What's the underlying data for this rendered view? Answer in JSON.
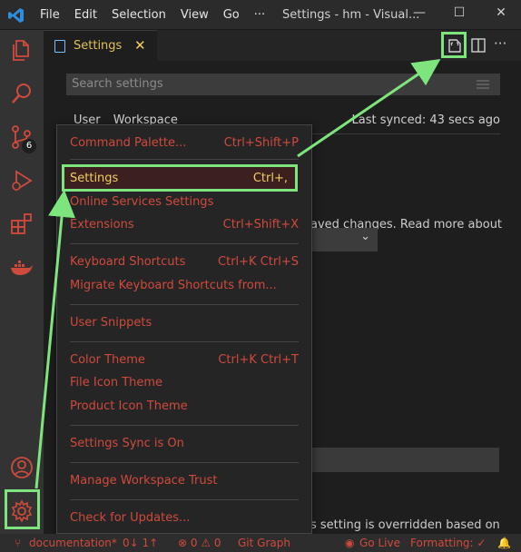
{
  "window": {
    "title": "Settings - hm - Visual...",
    "menu": [
      "File",
      "Edit",
      "Selection",
      "View",
      "Go",
      "···"
    ]
  },
  "activity_bar": {
    "scm_badge": "6"
  },
  "tab": {
    "label": "Settings",
    "close": "✕"
  },
  "settings": {
    "search_placeholder": "Search settings",
    "scopes": [
      "User",
      "Workspace"
    ],
    "last_synced": "Last synced: 43 secs ago",
    "background_text_1": "aved changes. Read more about",
    "background_text_2": "s setting is overridden based on"
  },
  "context_menu": {
    "items": [
      {
        "label": "Command Palette...",
        "key": "Ctrl+Shift+P"
      },
      {
        "label": "Settings",
        "key": "Ctrl+,"
      },
      {
        "label": "Online Services Settings",
        "key": ""
      },
      {
        "label": "Extensions",
        "key": "Ctrl+Shift+X"
      },
      {
        "label": "Keyboard Shortcuts",
        "key": "Ctrl+K Ctrl+S"
      },
      {
        "label": "Migrate Keyboard Shortcuts from...",
        "key": ""
      },
      {
        "label": "User Snippets",
        "key": ""
      },
      {
        "label": "Color Theme",
        "key": "Ctrl+K Ctrl+T"
      },
      {
        "label": "File Icon Theme",
        "key": ""
      },
      {
        "label": "Product Icon Theme",
        "key": ""
      },
      {
        "label": "Settings Sync is On",
        "key": ""
      },
      {
        "label": "Manage Workspace Trust",
        "key": ""
      },
      {
        "label": "Check for Updates...",
        "key": ""
      }
    ]
  },
  "status_bar": {
    "branch": "documentation*",
    "sync": "0↓ 1↑",
    "problems": "⊗ 0 ⚠ 0",
    "git_graph": "Git Graph",
    "go_live": "Go Live",
    "formatting": "Formatting: ✓"
  },
  "colors": {
    "highlight": "#7ee57e",
    "menu_text": "#d04a3c",
    "accent_text": "#f0d060"
  }
}
